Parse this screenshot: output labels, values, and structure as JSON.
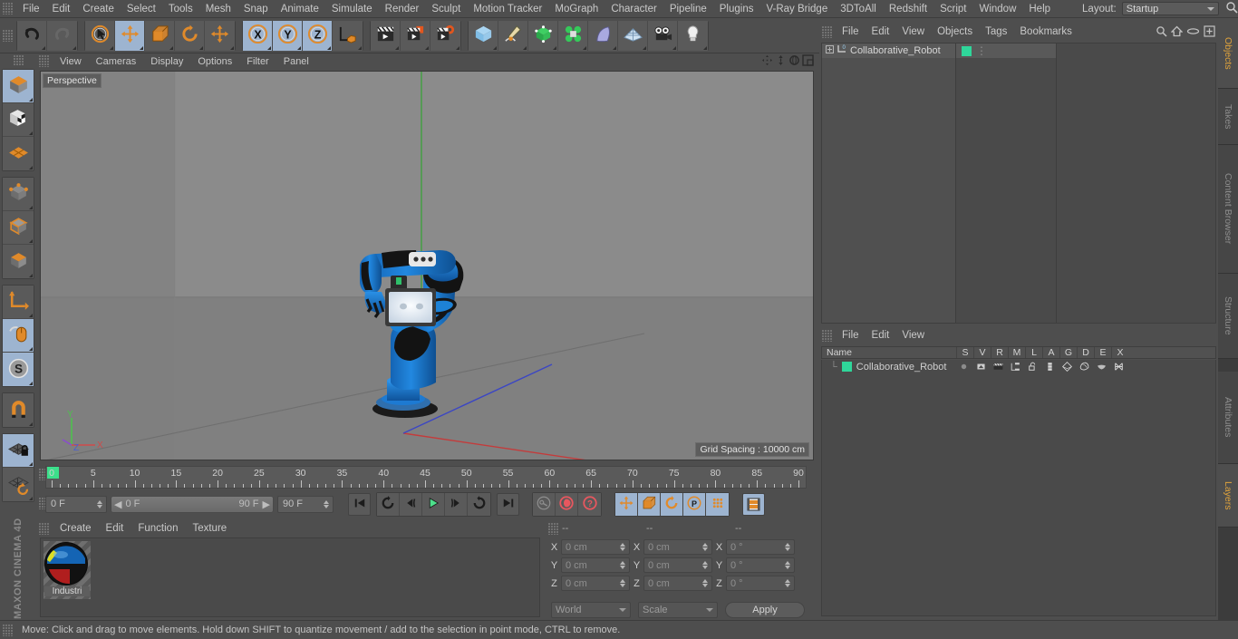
{
  "app": {
    "name": "MAXON CINEMA 4D",
    "brand_line1": "MAXON",
    "brand_line2": "CINEMA 4D"
  },
  "main_menu": {
    "items": [
      "File",
      "Edit",
      "Create",
      "Select",
      "Tools",
      "Mesh",
      "Snap",
      "Animate",
      "Simulate",
      "Render",
      "Sculpt",
      "Motion Tracker",
      "MoGraph",
      "Character",
      "Pipeline",
      "Plugins",
      "V-Ray Bridge",
      "3DToAll",
      "Redshift",
      "Script",
      "Window",
      "Help"
    ],
    "layout_label": "Layout:",
    "layout_value": "Startup",
    "search_icon": "magnifier-icon"
  },
  "toolbar": {
    "groups": [
      {
        "name": "history",
        "buttons": [
          {
            "name": "undo-button",
            "icon": "undo-arrow-icon",
            "active": false,
            "dim": false
          },
          {
            "name": "redo-button",
            "icon": "redo-arrow-icon",
            "active": false,
            "dim": true
          }
        ]
      },
      {
        "name": "transform-tools",
        "buttons": [
          {
            "name": "live-selection-tool",
            "icon": "cursor-circle-icon",
            "active": false,
            "dim": false
          },
          {
            "name": "move-tool",
            "icon": "move-arrows-icon",
            "active": true,
            "dim": false
          },
          {
            "name": "scale-tool",
            "icon": "scale-box-icon",
            "active": false,
            "dim": false
          },
          {
            "name": "rotate-tool",
            "icon": "rotate-circle-icon",
            "active": false,
            "dim": false
          },
          {
            "name": "move-tool-alt",
            "icon": "move-arrows-icon",
            "active": false,
            "dim": false
          }
        ]
      },
      {
        "name": "axis-locks",
        "buttons": [
          {
            "name": "lock-x-axis",
            "icon": "letter-x-icon",
            "active": true,
            "dim": false
          },
          {
            "name": "lock-y-axis",
            "icon": "letter-y-icon",
            "active": true,
            "dim": false
          },
          {
            "name": "lock-z-axis",
            "icon": "letter-z-icon",
            "active": true,
            "dim": false
          },
          {
            "name": "world-object-coordinates",
            "icon": "axis-cube-icon",
            "active": false,
            "dim": false
          }
        ]
      },
      {
        "name": "render-group",
        "buttons": [
          {
            "name": "render-view-button",
            "icon": "clapper-icon",
            "active": false,
            "dim": false
          },
          {
            "name": "render-to-picture-viewer-button",
            "icon": "clapper-render-icon",
            "active": false,
            "dim": false
          },
          {
            "name": "render-settings-button",
            "icon": "clapper-gear-icon",
            "active": false,
            "dim": false
          }
        ]
      },
      {
        "name": "create-group",
        "buttons": [
          {
            "name": "add-cube-button",
            "icon": "blue-cube-icon",
            "active": false,
            "dim": false
          },
          {
            "name": "add-spline-button",
            "icon": "pen-spline-icon",
            "active": false,
            "dim": false
          },
          {
            "name": "add-generator-button",
            "icon": "green-cube-icon",
            "active": false,
            "dim": false
          },
          {
            "name": "add-array-button",
            "icon": "green-cluster-icon",
            "active": false,
            "dim": false
          },
          {
            "name": "add-deformer-button",
            "icon": "bend-deformer-icon",
            "active": false,
            "dim": false
          },
          {
            "name": "add-scene-object-button",
            "icon": "floor-grid-icon",
            "active": false,
            "dim": false
          },
          {
            "name": "add-camera-button",
            "icon": "camera-icon",
            "active": false,
            "dim": false
          },
          {
            "name": "add-light-button",
            "icon": "lightbulb-icon",
            "active": false,
            "dim": false
          }
        ]
      }
    ]
  },
  "left_toolbar": {
    "groups": [
      {
        "name": "mode-group-1",
        "buttons": [
          {
            "name": "object-mode-button",
            "icon": "orange-cube-icon",
            "active": true
          },
          {
            "name": "texture-mode-button",
            "icon": "checker-cube-icon",
            "active": false
          },
          {
            "name": "deformer-mode-button",
            "icon": "orange-mesh-icon",
            "active": false
          }
        ]
      },
      {
        "name": "component-group",
        "buttons": [
          {
            "name": "points-mode-button",
            "icon": "points-cube-icon",
            "active": false
          },
          {
            "name": "edges-mode-button",
            "icon": "edges-cube-icon",
            "active": false
          },
          {
            "name": "polygons-mode-button",
            "icon": "polygons-cube-icon",
            "active": false
          }
        ]
      },
      {
        "name": "axis-group",
        "buttons": [
          {
            "name": "enable-axis-modification-button",
            "icon": "axis-L-icon",
            "active": false
          },
          {
            "name": "viewport-solo-button",
            "icon": "mouse-icon",
            "active": true
          },
          {
            "name": "enable-snapping-button",
            "icon": "letter-s-circle-icon",
            "active": true
          }
        ]
      },
      {
        "name": "magnet-group",
        "buttons": [
          {
            "name": "magnet-tool-button",
            "icon": "magnet-icon",
            "active": false
          }
        ]
      },
      {
        "name": "workplane-group",
        "buttons": [
          {
            "name": "lock-workplane-button",
            "icon": "grid-lock-icon",
            "active": true
          },
          {
            "name": "planar-workplane-button",
            "icon": "grid-rotate-icon",
            "active": false
          }
        ]
      }
    ]
  },
  "viewport": {
    "menu": [
      "View",
      "Cameras",
      "Display",
      "Options",
      "Filter",
      "Panel"
    ],
    "view_label": "Perspective",
    "grid_spacing": "Grid Spacing : 10000 cm",
    "corner_icons": [
      "pan-icon",
      "dolly-icon",
      "rotate-icon",
      "maximize-icon"
    ],
    "axis_gizmo": {
      "x": "X",
      "y": "Y",
      "z": "Z",
      "x_color": "#d04a4a",
      "y_color": "#4ec04e",
      "z_color": "#4a5ed0"
    },
    "scene_object": "Collaborative_Robot",
    "robot_colors": {
      "body": "#1a7fd4",
      "joint": "#141414",
      "screen": "#dfe6ef",
      "base": "#2a2a2a"
    }
  },
  "timeline": {
    "frame_labels": [
      "0",
      "5",
      "10",
      "15",
      "20",
      "25",
      "30",
      "35",
      "40",
      "45",
      "50",
      "55",
      "60",
      "65",
      "70",
      "75",
      "80",
      "85",
      "90"
    ],
    "current_frame": "0 F",
    "range_start": "0 F",
    "range_end": "90 F",
    "end_frame": "90 F",
    "playhead_frame": 0,
    "transport": [
      {
        "name": "go-to-start-button",
        "icon": "skip-start-icon",
        "active": false
      },
      {
        "name": "play-backwards-button",
        "icon": "loop-back-icon",
        "active": false
      },
      {
        "name": "previous-frame-button",
        "icon": "step-back-icon",
        "active": false
      },
      {
        "name": "play-forwards-button",
        "icon": "play-icon",
        "active": false
      },
      {
        "name": "next-frame-button",
        "icon": "step-forward-icon",
        "active": false
      },
      {
        "name": "loop-button",
        "icon": "loop-forward-icon",
        "active": false
      },
      {
        "name": "go-to-end-button",
        "icon": "skip-end-icon",
        "active": false
      }
    ],
    "record_group": [
      {
        "name": "record-active-objects-button",
        "icon": "key-icon",
        "active": false
      },
      {
        "name": "autokeying-button",
        "icon": "red-circle-icon",
        "active": false
      },
      {
        "name": "keyframe-selection-button",
        "icon": "question-circle-icon",
        "active": false
      }
    ],
    "key_group": [
      {
        "name": "record-position-button",
        "icon": "move-arrows-icon",
        "active": true
      },
      {
        "name": "record-scale-button",
        "icon": "scale-box-icon",
        "active": true
      },
      {
        "name": "record-rotation-button",
        "icon": "rotate-circle-icon",
        "active": true
      },
      {
        "name": "record-pla-button",
        "icon": "letter-p-circle-icon",
        "active": true
      },
      {
        "name": "record-parameter-button",
        "icon": "dots-grid-icon",
        "active": true
      }
    ],
    "timeline_toggle": {
      "name": "show-timeline-button",
      "icon": "filmstrip-icon",
      "active": true
    }
  },
  "material_manager": {
    "menu": [
      "Create",
      "Edit",
      "Function",
      "Texture"
    ],
    "materials": [
      {
        "name": "Industri",
        "swatch": "industrial-robot-material"
      }
    ]
  },
  "coordinates": {
    "headers": [
      "--",
      "--",
      "--"
    ],
    "rows": [
      {
        "axis": "X",
        "position": "0 cm",
        "size": "0 cm",
        "rotation": "0 °"
      },
      {
        "axis": "Y",
        "position": "0 cm",
        "size": "0 cm",
        "rotation": "0 °"
      },
      {
        "axis": "Z",
        "position": "0 cm",
        "size": "0 cm",
        "rotation": "0 °"
      }
    ],
    "coord_system": "World",
    "size_mode": "Scale",
    "apply_label": "Apply"
  },
  "object_manager": {
    "menu": [
      "File",
      "Edit",
      "View",
      "Objects",
      "Tags",
      "Bookmarks"
    ],
    "header_icons": [
      "magnifier-icon",
      "home-icon",
      "eye-icon",
      "plus-box-icon"
    ],
    "objects": [
      {
        "name": "Collaborative_Robot",
        "expand": "plus-box-icon",
        "type_icon": "null-object-icon",
        "level": "0",
        "tag_color": "#2fd69a"
      }
    ]
  },
  "layer_manager": {
    "menu": [
      "File",
      "Edit",
      "View"
    ],
    "columns": [
      "Name",
      "S",
      "V",
      "R",
      "M",
      "L",
      "A",
      "G",
      "D",
      "E",
      "X"
    ],
    "layers": [
      {
        "name": "Collaborative_Robot",
        "color": "#2fd69a",
        "icons": [
          "solo-dot-icon",
          "visible-icon",
          "render-icon",
          "manager-icon",
          "lock-open-icon",
          "animation-icon",
          "generators-icon",
          "deformers-icon",
          "expressions-icon",
          "xpresso-icon"
        ]
      }
    ]
  },
  "right_tabs": {
    "top": [
      {
        "label": "Objects",
        "active": true
      },
      {
        "label": "Takes",
        "active": false
      },
      {
        "label": "Content Browser",
        "active": false
      },
      {
        "label": "Structure",
        "active": false
      }
    ],
    "bottom": [
      {
        "label": "Attributes",
        "active": false
      },
      {
        "label": "Layers",
        "active": true
      }
    ]
  },
  "status_bar": {
    "message": "Move: Click and drag to move elements. Hold down SHIFT to quantize movement / add to the selection in point mode, CTRL to remove."
  }
}
